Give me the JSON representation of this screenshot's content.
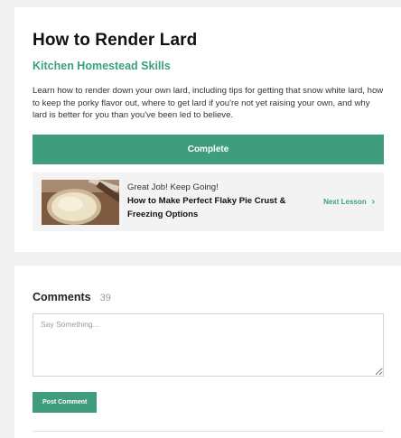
{
  "lesson": {
    "title": "How to Render Lard",
    "course": "Kitchen Homestead Skills",
    "description": "Learn how to render down your own lard, including tips for getting that snow white lard, how to keep the porky flavor out, where to get lard if you're not yet raising your own, and why lard is better for you than you've been led to believe.",
    "complete_label": "Complete"
  },
  "next_lesson": {
    "encouragement": "Great Job! Keep Going!",
    "title": "How to Make Perfect Flaky Pie Crust & Freezing Options",
    "link_label": "Next Lesson",
    "link_icon": "chevron-right-icon"
  },
  "comments": {
    "heading": "Comments",
    "count": "39",
    "placeholder": "Say Something...",
    "post_label": "Post Comment"
  },
  "colors": {
    "accent": "#3f9d7e",
    "accent_text": "#3a9f82",
    "page_bg": "#f1f1f1"
  }
}
